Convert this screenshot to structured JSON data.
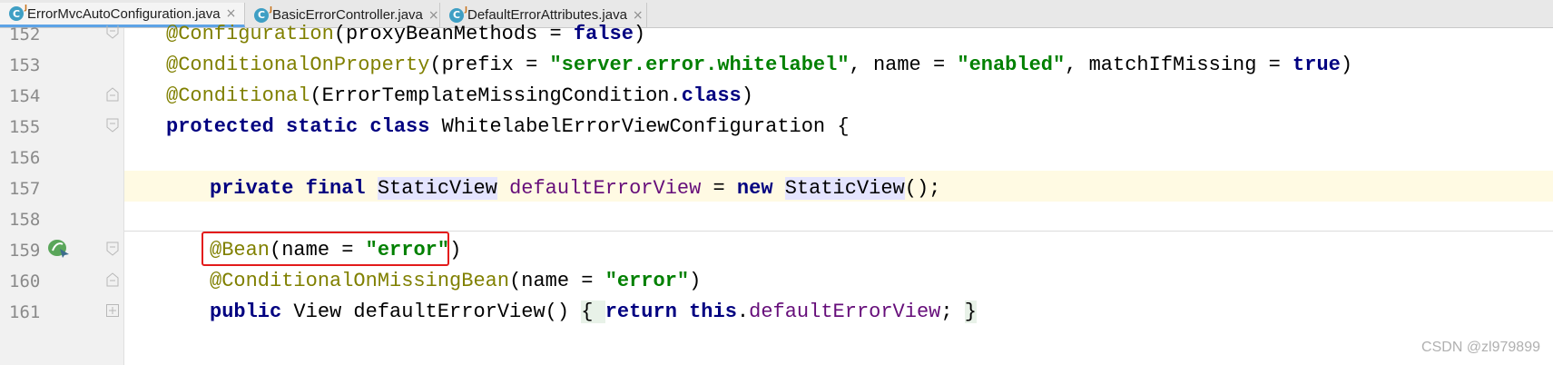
{
  "tabs": [
    {
      "label": "ErrorMvcAutoConfiguration.java",
      "active": true
    },
    {
      "label": "BasicErrorController.java",
      "active": false
    },
    {
      "label": "DefaultErrorAttributes.java",
      "active": false
    }
  ],
  "file_icon_letter": "C",
  "close_glyph": "×",
  "line_numbers": [
    "152",
    "153",
    "154",
    "155",
    "156",
    "157",
    "158",
    "159",
    "160",
    "161"
  ],
  "code": {
    "l152": {
      "ann": "@Configuration",
      "p1": "(proxyBeanMethods = ",
      "kw": "false",
      "p2": ")"
    },
    "l153": {
      "ann": "@ConditionalOnProperty",
      "p1": "(prefix = ",
      "s1": "\"server.error.whitelabel\"",
      "p2": ", name = ",
      "s2": "\"enabled\"",
      "p3": ", matchIfMissing = ",
      "kw": "true",
      "p4": ")"
    },
    "l154": {
      "ann": "@Conditional",
      "p1": "(ErrorTemplateMissingCondition.",
      "kw": "class",
      "p2": ")"
    },
    "l155": {
      "kw": "protected static class",
      "p1": " WhitelabelErrorViewConfiguration {"
    },
    "l157": {
      "kw1": "private final",
      "t1": "StaticView",
      "f1": "defaultErrorView",
      "p1": " = ",
      "kw2": "new",
      "t2": "StaticView",
      "p2": "();"
    },
    "l159": {
      "ann": "@Bean",
      "p1": "(name = ",
      "s1": "\"error\"",
      "p2": ")"
    },
    "l160": {
      "ann": "@ConditionalOnMissingBean",
      "p1": "(name = ",
      "s1": "\"error\"",
      "p2": ")"
    },
    "l161": {
      "kw1": "public",
      "p1": " View defaultErrorView() ",
      "b1": "{ ",
      "kw2": "return this",
      "p2": ".",
      "f1": "defaultErrorView",
      "p3": "; ",
      "b2": "}"
    }
  },
  "watermark": "CSDN @zl979899",
  "colors": {
    "keyword": "#000080",
    "annotation": "#808000",
    "string": "#008000",
    "field": "#660e7a",
    "current_line": "#fffae3",
    "highlight_box": "#e31b1b"
  }
}
